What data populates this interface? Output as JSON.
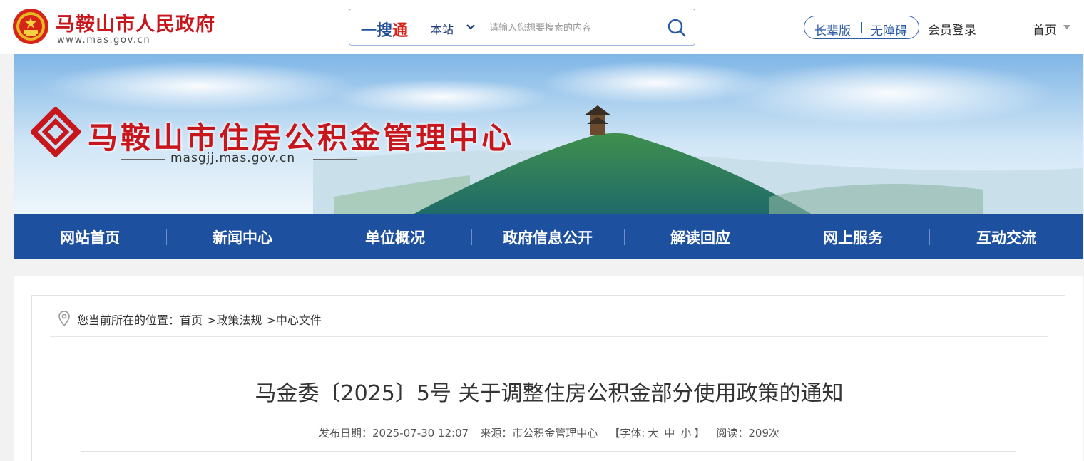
{
  "header": {
    "gov_title": "马鞍山市人民政府",
    "gov_url": "www.mas.gov.cn"
  },
  "search": {
    "brand_a": "一搜",
    "brand_b": "通",
    "scope": "本站",
    "placeholder": "请输入您想要搜索的内容"
  },
  "toolbar": {
    "elder_mode": "长辈版",
    "accessibility": "无障碍",
    "member_login": "会员登录",
    "home": "首页"
  },
  "banner": {
    "title": "马鞍山市住房公积金管理中心",
    "url": "masgjj.mas.gov.cn"
  },
  "nav": {
    "items": [
      {
        "label": "网站首页"
      },
      {
        "label": "新闻中心"
      },
      {
        "label": "单位概况"
      },
      {
        "label": "政府信息公开"
      },
      {
        "label": "解读回应"
      },
      {
        "label": "网上服务"
      },
      {
        "label": "互动交流"
      }
    ]
  },
  "breadcrumb": {
    "prefix": "您当前所在的位置：",
    "items": [
      "首页",
      "政策法规",
      "中心文件"
    ],
    "separator": ">"
  },
  "article": {
    "title": "马金委〔2025〕5号 关于调整住房公积金部分使用政策的通知",
    "publish_label": "发布日期：",
    "publish_date": "2025-07-30 12:07",
    "source_label": "来源：",
    "source": "市公积金管理中心",
    "font_open": "【字体:",
    "font_large": "大",
    "font_medium": "中",
    "font_small": "小",
    "font_close": "】",
    "reads_label": "阅读：",
    "reads": "209次"
  },
  "colors": {
    "brand_red": "#c8161d",
    "nav_blue": "#1e50a0"
  }
}
